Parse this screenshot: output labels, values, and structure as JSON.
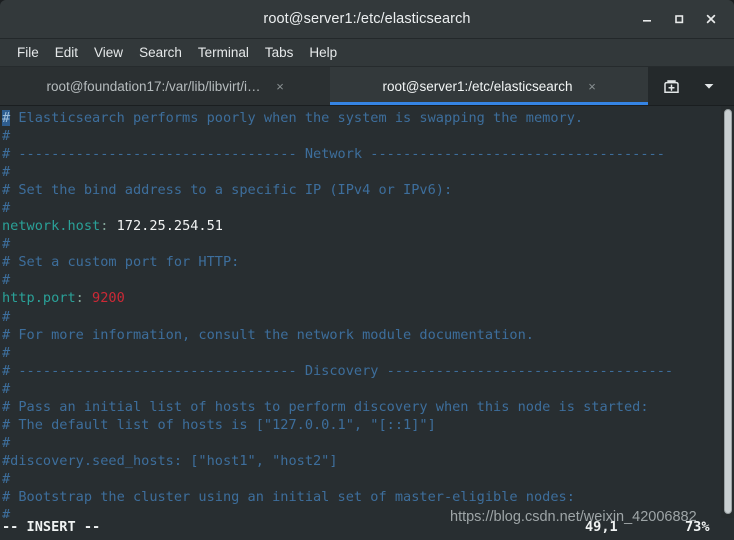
{
  "window": {
    "title": "root@server1:/etc/elasticsearch",
    "controls": [
      {
        "name": "minimize-button",
        "glyph": "minimize"
      },
      {
        "name": "maximize-button",
        "glyph": "maximize"
      },
      {
        "name": "close-button",
        "glyph": "close"
      }
    ]
  },
  "menubar": {
    "items": [
      {
        "label": "File"
      },
      {
        "label": "Edit"
      },
      {
        "label": "View"
      },
      {
        "label": "Search"
      },
      {
        "label": "Terminal"
      },
      {
        "label": "Tabs"
      },
      {
        "label": "Help"
      }
    ]
  },
  "tabs": {
    "items": [
      {
        "label": "root@foundation17:/var/lib/libvirt/i…",
        "active": false,
        "close_glyph": "×"
      },
      {
        "label": "root@server1:/etc/elasticsearch",
        "active": true,
        "close_glyph": "×"
      }
    ],
    "new_tab_icon": "new-tab-icon",
    "menu_icon": "chevron-down-icon"
  },
  "terminal": {
    "lines": [
      {
        "segments": [
          {
            "text": "#",
            "class": "cursor-blk"
          },
          {
            "text": " Elasticsearch performs poorly when the system is swapping the memory.",
            "class": "c-comment"
          }
        ]
      },
      {
        "segments": [
          {
            "text": "#",
            "class": "c-comment"
          }
        ]
      },
      {
        "segments": [
          {
            "text": "# ---------------------------------- Network ------------------------------------",
            "class": "c-comment"
          }
        ]
      },
      {
        "segments": [
          {
            "text": "#",
            "class": "c-comment"
          }
        ]
      },
      {
        "segments": [
          {
            "text": "# Set the bind address to a specific IP (IPv4 or IPv6):",
            "class": "c-comment"
          }
        ]
      },
      {
        "segments": [
          {
            "text": "#",
            "class": "c-comment"
          }
        ]
      },
      {
        "segments": [
          {
            "text": "network.host",
            "class": "c-key"
          },
          {
            "text": ":",
            "class": "c-punct"
          },
          {
            "text": " 172.25.254.51",
            "class": "c-val"
          }
        ]
      },
      {
        "segments": [
          {
            "text": "#",
            "class": "c-comment"
          }
        ]
      },
      {
        "segments": [
          {
            "text": "# Set a custom port for HTTP:",
            "class": "c-comment"
          }
        ]
      },
      {
        "segments": [
          {
            "text": "#",
            "class": "c-comment"
          }
        ]
      },
      {
        "segments": [
          {
            "text": "http.port",
            "class": "c-key"
          },
          {
            "text": ":",
            "class": "c-punct"
          },
          {
            "text": " ",
            "class": "c-val"
          },
          {
            "text": "9200",
            "class": "c-num"
          }
        ]
      },
      {
        "segments": [
          {
            "text": "#",
            "class": "c-comment"
          }
        ]
      },
      {
        "segments": [
          {
            "text": "# For more information, consult the network module documentation.",
            "class": "c-comment"
          }
        ]
      },
      {
        "segments": [
          {
            "text": "#",
            "class": "c-comment"
          }
        ]
      },
      {
        "segments": [
          {
            "text": "# ---------------------------------- Discovery -----------------------------------",
            "class": "c-comment"
          }
        ]
      },
      {
        "segments": [
          {
            "text": "#",
            "class": "c-comment"
          }
        ]
      },
      {
        "segments": [
          {
            "text": "# Pass an initial list of hosts to perform discovery when this node is started:",
            "class": "c-comment"
          }
        ]
      },
      {
        "segments": [
          {
            "text": "# The default list of hosts is [\"127.0.0.1\", \"[::1]\"]",
            "class": "c-comment"
          }
        ]
      },
      {
        "segments": [
          {
            "text": "#",
            "class": "c-comment"
          }
        ]
      },
      {
        "segments": [
          {
            "text": "#discovery.seed_hosts: [\"host1\", \"host2\"]",
            "class": "c-comment"
          }
        ]
      },
      {
        "segments": [
          {
            "text": "#",
            "class": "c-comment"
          }
        ]
      },
      {
        "segments": [
          {
            "text": "# Bootstrap the cluster using an initial set of master-eligible nodes:",
            "class": "c-comment"
          }
        ]
      },
      {
        "segments": [
          {
            "text": "#",
            "class": "c-comment"
          }
        ]
      }
    ]
  },
  "statusbar": {
    "mode": "-- INSERT --",
    "position": "49,1",
    "percent": "73%"
  },
  "watermark": {
    "text": "https://blog.csdn.net/weixin_42006882"
  }
}
